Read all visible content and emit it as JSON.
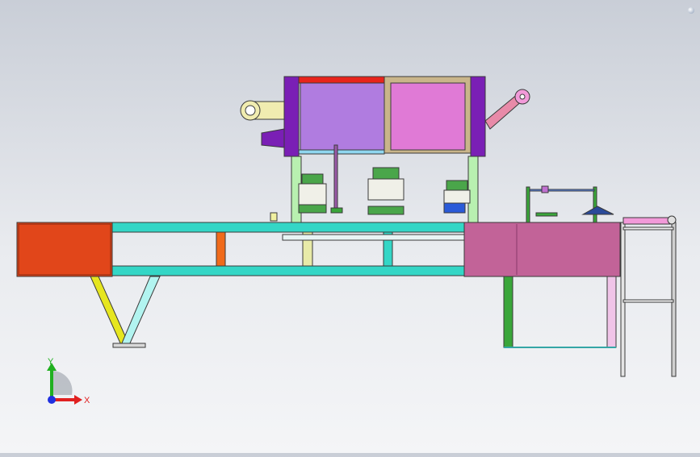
{
  "viewport": {
    "background_top": "#c9ced7",
    "background_bottom": "#f4f5f7"
  },
  "model": {
    "colors": {
      "rail": "#34d6c6",
      "left_box": "#e1461a",
      "right_box": "#c26398",
      "chamber_left": "#b07ce0",
      "chamber_right": "#e07ad6",
      "chamber_frame": "#7a1fb5",
      "top_bar": "#e8241c",
      "outline": "#3a3a3a"
    }
  },
  "triad": {
    "x_label": "X",
    "y_label": "Y",
    "x_color": "#e02020",
    "y_color": "#20b020",
    "z_color": "#2030e0"
  },
  "icons": {
    "orientation": "coordinate-triad-icon",
    "corner": "viewport-corner-icon"
  }
}
